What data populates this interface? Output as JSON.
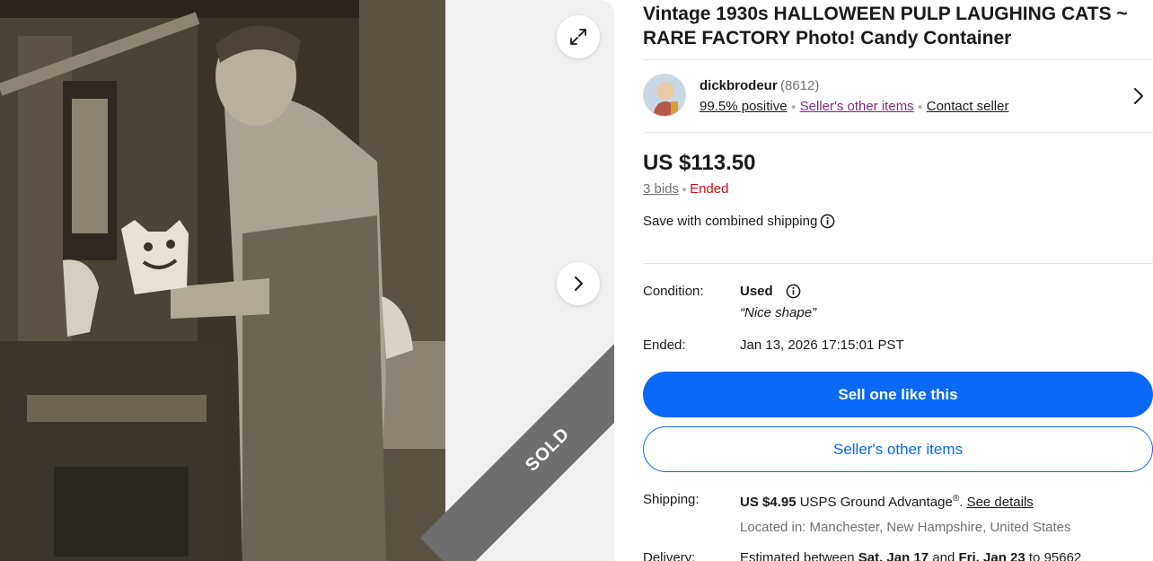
{
  "listing": {
    "title": "Vintage 1930s HALLOWEEN PULP LAUGHING CATS ~ RARE FACTORY Photo! Candy Container",
    "sold_badge": "SOLD"
  },
  "seller": {
    "name": "dickbrodeur",
    "feedback_count": "(8612)",
    "positive": "99.5% positive",
    "other_items": "Seller's other items",
    "contact": "Contact seller"
  },
  "pricing": {
    "price": "US $113.50",
    "bids": "3 bids",
    "status": "Ended",
    "combined_shipping": "Save with combined shipping"
  },
  "details": {
    "condition_label": "Condition:",
    "condition_value": "Used",
    "condition_note": "“Nice shape”",
    "ended_label": "Ended:",
    "ended_value": "Jan 13, 2026 17:15:01 PST"
  },
  "actions": {
    "sell_one": "Sell one like this",
    "sellers_other": "Seller's other items"
  },
  "shipping": {
    "label": "Shipping:",
    "cost": "US $4.95",
    "service": "USPS Ground Advantage",
    "registered": "®",
    "see_details": "See details",
    "located": "Located in: Manchester, New Hampshire, United States"
  },
  "delivery": {
    "label": "Delivery:",
    "text_prefix": "Estimated between",
    "start": "Sat, Jan 17",
    "and": "and",
    "end": "Fri, Jan 23",
    "to": "to 95662"
  },
  "colors": {
    "primary_blue": "#0968f6",
    "ended_red": "#d50b0b",
    "link_purple": "#7b2b84"
  },
  "icons": [
    "expand-icon",
    "chevron-right-icon",
    "info-icon"
  ]
}
